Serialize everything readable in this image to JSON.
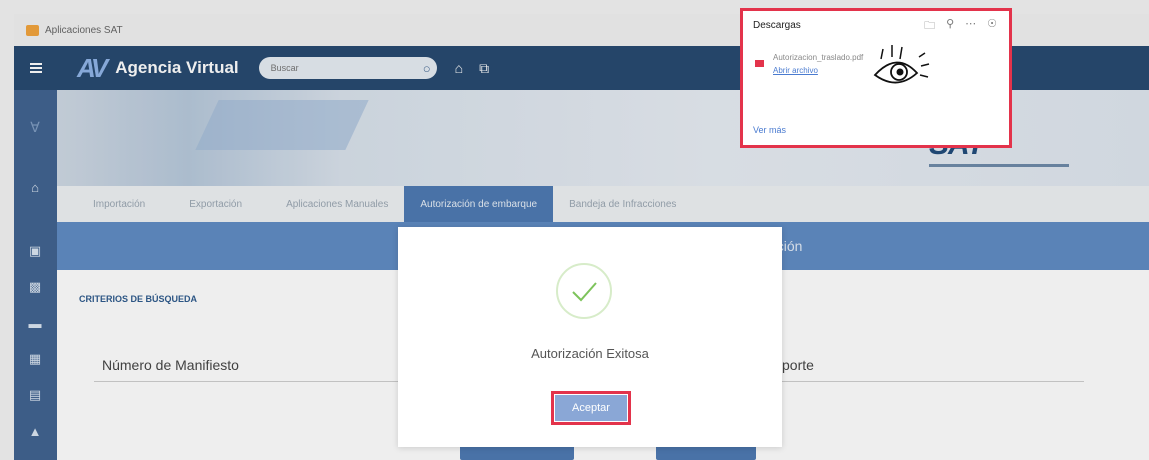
{
  "window": {
    "title": "Aplicaciones SAT"
  },
  "header": {
    "logo_text": "AV",
    "brand": "Agencia Virtual",
    "search_placeholder": "Buscar"
  },
  "banner": {
    "logo": "SAT"
  },
  "tabs": [
    {
      "label": "Importación"
    },
    {
      "label": "Exportación"
    },
    {
      "label": "Aplicaciones Manuales"
    },
    {
      "label": "Autorización de embarque",
      "active": true
    },
    {
      "label": "Bandeja de Infracciones"
    }
  ],
  "band": {
    "title": "ación"
  },
  "criteria": {
    "title": "CRITERIOS DE BÚSQUEDA",
    "field1": "Número de Manifiesto",
    "field2": "porte"
  },
  "modal": {
    "message": "Autorización Exitosa",
    "accept_label": "Aceptar"
  },
  "downloads": {
    "title": "Descargas",
    "file_name": "Autorizacion_traslado.pdf",
    "open_label": "Abrir archivo",
    "more_label": "Ver más"
  },
  "colors": {
    "header": "#25486f",
    "sidebar": "#3f6290",
    "active_tab": "#4d79b2",
    "highlight": "#e3334b",
    "success": "#7dc35b"
  },
  "icons": {
    "sidebar": [
      "home-icon",
      "monitor-icon",
      "clipboard-icon",
      "folder-icon",
      "plus-box-icon",
      "document-icon",
      "bank-icon"
    ],
    "header": [
      "menu-icon",
      "search-icon",
      "home-icon",
      "copy-icon"
    ],
    "downloads": [
      "folder-icon",
      "search-icon",
      "more-icon",
      "pin-icon",
      "pdf-icon"
    ]
  }
}
